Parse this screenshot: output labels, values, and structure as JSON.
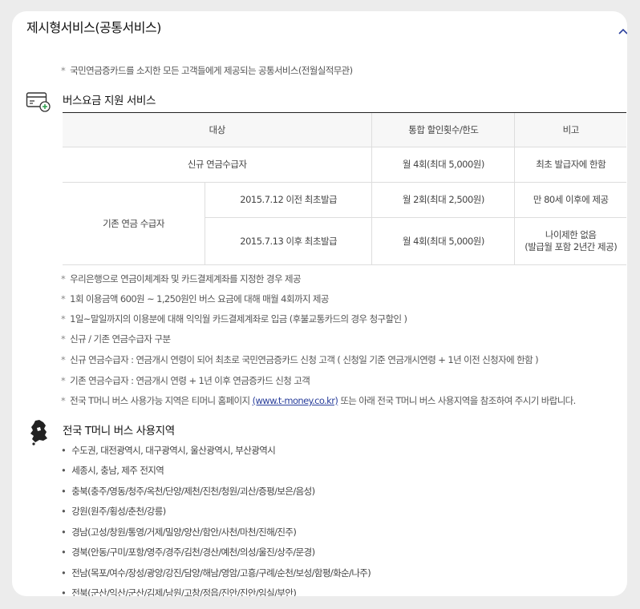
{
  "section": {
    "title": "제시형서비스(공통서비스)",
    "intro_note": "국민연금증카드를 소지한 모든 고객들에게 제공되는 공통서비스(전월실적무관)"
  },
  "icons": {
    "collapse": "chevron-up-icon",
    "bus_section": "card-plus-icon",
    "region_section": "korea-map-icon"
  },
  "colors": {
    "accent": "#2a3f9c",
    "header_border": "#222222"
  },
  "bus_service": {
    "title": "버스요금 지원 서비스",
    "headers": [
      "대상",
      "통합 할인횟수/한도",
      "비고"
    ],
    "row_new": {
      "target": "신규 연금수급자",
      "discount": "월 4회(최대 5,000원)",
      "remark": "최초 발급자에 한함"
    },
    "existing_group": "기존 연금 수급자",
    "row_before": {
      "date": "2015.7.12 이전 최초발급",
      "discount": "월 2회(최대 2,500원)",
      "remark": "만 80세 이후에 제공"
    },
    "row_after": {
      "date": "2015.7.13 이후 최초발급",
      "discount": "월 4회(최대 5,000원)",
      "remark_line1": "나이제한 없음",
      "remark_line2": "(발급월 포함 2년간 제공)"
    },
    "notes": [
      "우리은행으로 연금이체계좌 및 카드결제계좌를 지정한 경우 제공",
      "1회 이용금액 600원 ~ 1,250원인 버스 요금에 대해 매월 4회까지 제공",
      "1일~말일까지의 이용분에 대해 익익월 카드결제계좌로 입금 (후불교통카드의 경우 청구할인 )",
      "신규 / 기존 연금수급자 구분",
      "신규 연금수급자 : 연금개시 연령이 되어 최초로 국민연금증카드 신청 고객 ( 신청일 기준 연금개시연령 + 1년 이전 신청자에 한함 )",
      "기존 연금수급자 : 연금개시 연령 + 1년 이후 연금증카드 신청 고객"
    ],
    "last_note_before": "전국 T머니 버스 사용가능 지역은 티머니 홈페이지",
    "last_note_link": "(www.t-money.co.kr)",
    "last_note_after": "또는 아래 전국 T머니 버스 사용지역을 참조하여 주시기 바랍니다."
  },
  "regions": {
    "title": "전국 T머니 버스 사용지역",
    "items": [
      "수도권, 대전광역시, 대구광역시, 울산광역시, 부산광역시",
      "세종시, 충남, 제주 전지역",
      "충북(충주/영동/청주/옥천/단양/제천/진천/청원/괴산/증평/보은/음성)",
      "강원(원주/횡성/춘천/강릉)",
      "경남(고성/창원/통영/거제/밀양/양산/함안/사천/마천/진해/진주)",
      "경북(안동/구미/포항/영주/경주/김천/경산/예천/의성/울진/상주/문경)",
      "전남(목포/여수/장성/광양/강진/담양/해남/영암/고흥/구례/순천/보성/함평/화순/나주)",
      "전북(군산/익산/군산/김제/남원/고창/정읍/진안/진안/임실/부안)"
    ]
  }
}
